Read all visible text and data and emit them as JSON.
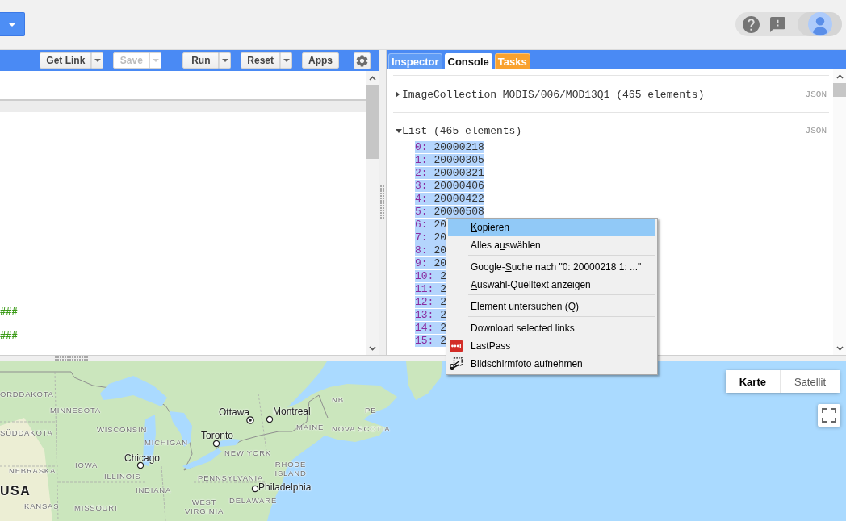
{
  "toolbar": {
    "buttons": [
      {
        "label": "Get Link",
        "kind": "split",
        "disabled": false
      },
      {
        "label": "Save",
        "kind": "split",
        "disabled": true
      },
      {
        "label": "Run",
        "kind": "split",
        "disabled": false
      },
      {
        "label": "Reset",
        "kind": "split",
        "disabled": false
      },
      {
        "label": "Apps",
        "kind": "plain",
        "disabled": false
      }
    ]
  },
  "editor": {
    "lines": [
      "###",
      "###"
    ]
  },
  "console_tabs": [
    {
      "label": "Inspector",
      "selected": false,
      "color": "#5f9cf6"
    },
    {
      "label": "Console",
      "selected": true,
      "color": "#ffffff"
    },
    {
      "label": "Tasks",
      "selected": false,
      "color": "#f9a22f"
    }
  ],
  "console": {
    "entries": [
      {
        "label": "ImageCollection MODIS/006/MOD13Q1 (465 elements)",
        "expanded": false,
        "format": "JSON"
      },
      {
        "label": "List (465 elements)",
        "expanded": true,
        "format": "JSON",
        "items": [
          {
            "index": "0:",
            "value": "20000218",
            "selected": true
          },
          {
            "index": "1:",
            "value": "20000305",
            "selected": true
          },
          {
            "index": "2:",
            "value": "20000321",
            "selected": true
          },
          {
            "index": "3:",
            "value": "20000406",
            "selected": true
          },
          {
            "index": "4:",
            "value": "20000422",
            "selected": true
          },
          {
            "index": "5:",
            "value": "20000508",
            "selected": true
          },
          {
            "index": "6:",
            "value": "20",
            "selected": true
          },
          {
            "index": "7:",
            "value": "20",
            "selected": true
          },
          {
            "index": "8:",
            "value": "20",
            "selected": true
          },
          {
            "index": "9:",
            "value": "20",
            "selected": true
          },
          {
            "index": "10:",
            "value": "2",
            "selected": true
          },
          {
            "index": "11:",
            "value": "2",
            "selected": true
          },
          {
            "index": "12:",
            "value": "2",
            "selected": true
          },
          {
            "index": "13:",
            "value": "2",
            "selected": true
          },
          {
            "index": "14:",
            "value": "2",
            "selected": true
          },
          {
            "index": "15:",
            "value": "2",
            "selected": true
          }
        ]
      }
    ]
  },
  "context_menu": {
    "groups": [
      [
        {
          "kind": "plain",
          "accel": "K",
          "rest": "opieren",
          "selected": true
        },
        {
          "kind": "plain",
          "lead": "Alles a",
          "accel": "u",
          "rest": "swählen",
          "selected": false
        }
      ],
      [
        {
          "kind": "plain",
          "lead": "Google-",
          "accel": "S",
          "rest": "uche nach \"0: 20000218 1: ...\"",
          "selected": false
        },
        {
          "kind": "plain",
          "accel": "A",
          "rest": "uswahl-Quelltext anzeigen",
          "selected": false
        }
      ],
      [
        {
          "kind": "plain",
          "lead": "Element untersuchen (",
          "accel": "Q",
          "rest": ")",
          "selected": false
        }
      ],
      [
        {
          "kind": "plain",
          "lead": "Download selected links",
          "selected": false
        },
        {
          "kind": "extension",
          "lead": "LastPass",
          "selected": false
        },
        {
          "kind": "capture",
          "lead": "Bildschirmfoto aufnehmen",
          "selected": false
        }
      ]
    ]
  },
  "map": {
    "types": [
      {
        "label": "Karte",
        "selected": true
      },
      {
        "label": "Satellit",
        "selected": false
      }
    ],
    "labels": [
      {
        "text": "ORDDAKOTA",
        "kind": "region"
      },
      {
        "text": "NB",
        "kind": "region"
      },
      {
        "text": "MINNESOTA",
        "kind": "region"
      },
      {
        "text": "Ottawa",
        "kind": "capital"
      },
      {
        "text": "Montreal",
        "kind": "city"
      },
      {
        "text": "PE",
        "kind": "region"
      },
      {
        "text": "SÜDDAKOTA",
        "kind": "region"
      },
      {
        "text": "WISCONSIN",
        "kind": "region"
      },
      {
        "text": "MICHIGAN",
        "kind": "region"
      },
      {
        "text": "Toronto",
        "kind": "city"
      },
      {
        "text": "MAINE",
        "kind": "region"
      },
      {
        "text": "NOVA SCOTIA",
        "kind": "region"
      },
      {
        "text": "Chicago",
        "kind": "city"
      },
      {
        "text": "NEW YORK",
        "kind": "region"
      },
      {
        "text": "NEBRASKA",
        "kind": "region"
      },
      {
        "text": "IOWA",
        "kind": "region"
      },
      {
        "text": "ILLINOIS",
        "kind": "region"
      },
      {
        "text": "PENNSYLVANIA",
        "kind": "region"
      },
      {
        "text": "RHODE ISLAND",
        "kind": "region"
      },
      {
        "text": "USA",
        "kind": "country"
      },
      {
        "text": "INDIANA",
        "kind": "region"
      },
      {
        "text": "Philadelphia",
        "kind": "city"
      },
      {
        "text": "KANSAS",
        "kind": "region"
      },
      {
        "text": "MISSOURI",
        "kind": "region"
      },
      {
        "text": "WEST VIRGINIA",
        "kind": "region"
      },
      {
        "text": "DELAWARE",
        "kind": "region"
      }
    ]
  }
}
